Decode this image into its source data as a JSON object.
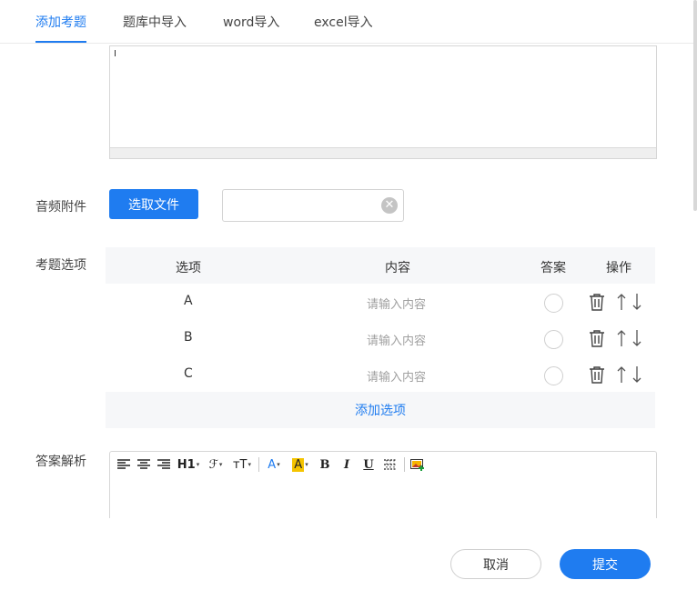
{
  "tabs": [
    {
      "label": "添加考题",
      "active": true
    },
    {
      "label": "题库中导入"
    },
    {
      "label": "word导入"
    },
    {
      "label": "excel导入"
    }
  ],
  "form": {
    "audio_label": "音频附件",
    "select_file_label": "选取文件",
    "file_value": "",
    "options_label": "考题选项",
    "analysis_label": "答案解析"
  },
  "options_table": {
    "headers": [
      "选项",
      "内容",
      "答案",
      "操作"
    ],
    "rows": [
      {
        "letter": "A",
        "content_placeholder": "请输入内容"
      },
      {
        "letter": "B",
        "content_placeholder": "请输入内容"
      },
      {
        "letter": "C",
        "content_placeholder": "请输入内容"
      }
    ],
    "add_label": "添加选项"
  },
  "toolbar": {
    "heading": "H1",
    "font": "ℱ",
    "font_size": "тT",
    "font_color": "A",
    "highlight": "A",
    "bold": "B",
    "italic": "I",
    "underline": "U"
  },
  "colors": {
    "accent": "#1f7cf0",
    "highlight_bg": "#f5c400"
  },
  "footer": {
    "cancel": "取消",
    "submit": "提交"
  }
}
